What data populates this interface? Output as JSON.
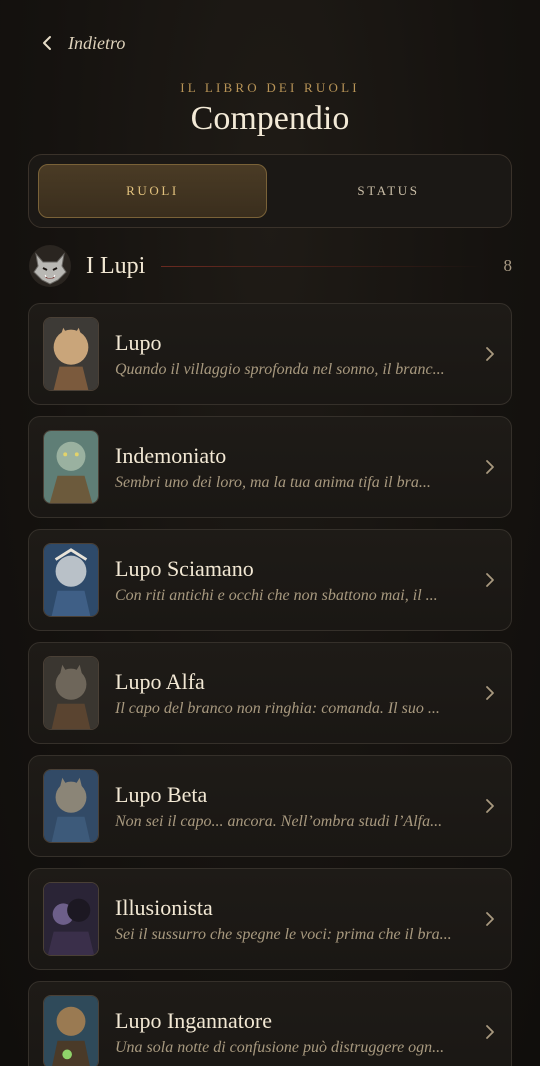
{
  "nav": {
    "back_label": "Indietro"
  },
  "header": {
    "overline": "IL LIBRO DEI RUOLI",
    "title": "Compendio"
  },
  "tabs": [
    {
      "label": "RUOLI",
      "active": true
    },
    {
      "label": "STATUS",
      "active": false
    }
  ],
  "group": {
    "name": "I Lupi",
    "count": "8",
    "icon": "wolf-head-icon"
  },
  "roles": [
    {
      "name": "Lupo",
      "desc": "Quando il villaggio sprofonda nel sonno, il branc...",
      "palette": [
        "#c9a57a",
        "#7b5a3d"
      ]
    },
    {
      "name": "Indemoniato",
      "desc": "Sembri uno dei loro, ma la tua anima tifa il bra...",
      "palette": [
        "#9ab1a0",
        "#6c5a3c"
      ]
    },
    {
      "name": "Lupo Sciamano",
      "desc": "Con riti antichi e occhi che non sbattono mai, il ...",
      "palette": [
        "#b9c1c8",
        "#3f5f86"
      ]
    },
    {
      "name": "Lupo Alfa",
      "desc": "Il capo del branco non ringhia: comanda. Il suo ...",
      "palette": [
        "#6e665a",
        "#5a4430"
      ]
    },
    {
      "name": "Lupo Beta",
      "desc": "Non sei il capo... ancora. Nell’ombra studi l’Alfa...",
      "palette": [
        "#8b8577",
        "#3d5a7a"
      ]
    },
    {
      "name": "Illusionista",
      "desc": "Sei il sussurro che spegne le voci: prima che il bra...",
      "palette": [
        "#6d5f8a",
        "#3a2f4a"
      ]
    },
    {
      "name": "Lupo Ingannatore",
      "desc": "Una sola notte di confusione può distruggere ogn...",
      "palette": [
        "#9a7a52",
        "#2f4a5a"
      ]
    }
  ]
}
